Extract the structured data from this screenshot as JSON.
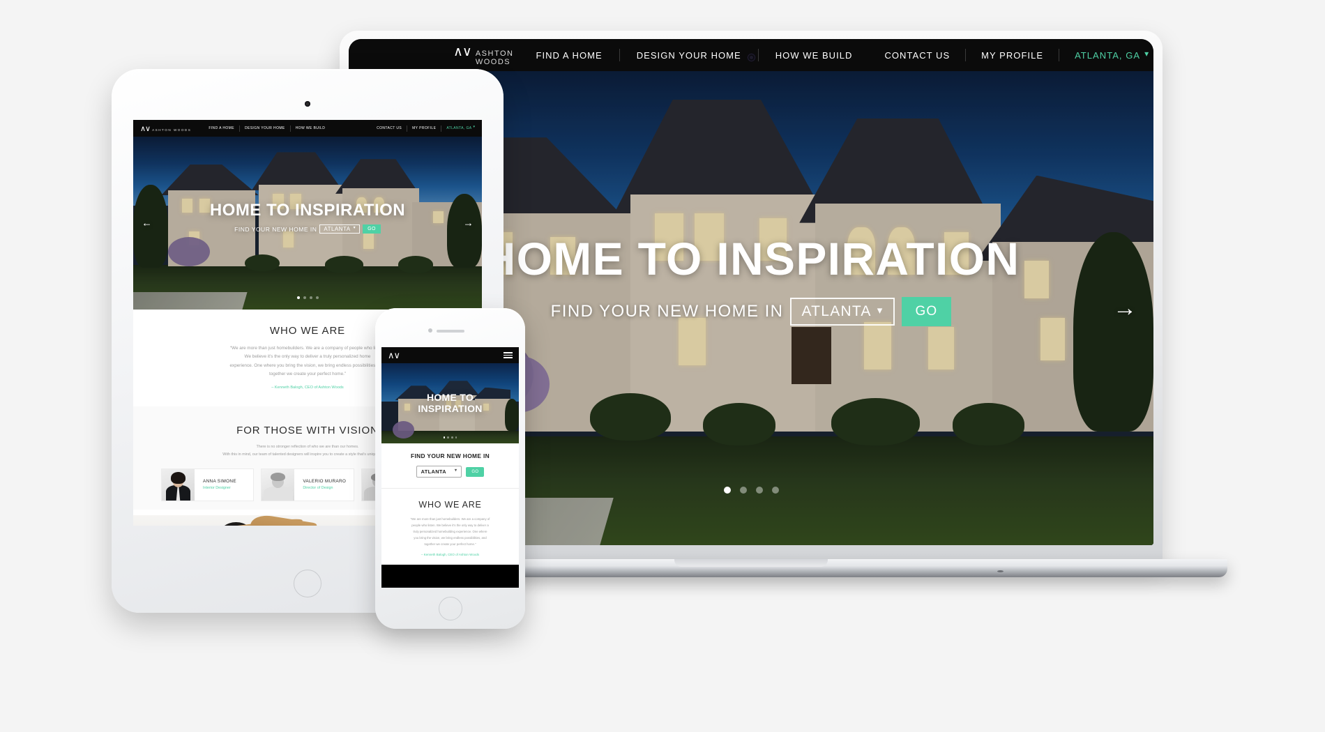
{
  "scene": {
    "background_color": "#f4f4f4",
    "devices": [
      "laptop",
      "tablet",
      "phone"
    ]
  },
  "brand": {
    "name": "ASHTON WOODS",
    "logo_mark": "AW",
    "accent_color": "#4fd1a5",
    "nav_background": "#0b0b0b"
  },
  "nav": {
    "links": [
      "FIND A HOME",
      "DESIGN YOUR HOME",
      "HOW WE BUILD"
    ],
    "right_links": [
      "CONTACT US",
      "MY PROFILE"
    ],
    "location": "ATLANTA, GA",
    "location_chevron": "chevron-down-icon",
    "mobile_menu_icon": "hamburger-icon"
  },
  "hero": {
    "title": "HOME TO INSPIRATION",
    "title_line1": "HOME TO",
    "title_line2": "INSPIRATION",
    "subtitle": "FIND YOUR NEW HOME IN",
    "city_selected": "ATLANTA",
    "city_options": [
      "ATLANTA"
    ],
    "go_label": "GO",
    "prev_icon": "arrow-left-icon",
    "next_icon": "arrow-right-icon",
    "slide_count": 4,
    "active_slide": 1,
    "photo_alt": "luxury-home-at-dusk"
  },
  "who_we_are": {
    "title": "WHO WE ARE",
    "quote": "“We are more than just homebuilders. We are a company of people who listen. We believe it’s the only way to deliver a truly personalized homebuilding experience. One where you bring the vision, we bring endless possibilities, and together we create your perfect home.”",
    "quote_lines": [
      "“We are more than just homebuilders. We are a company of people who listen.",
      "We believe it’s the only way to deliver a truly personalized home",
      "experience. One where you bring the vision, we bring endless possibilities, and",
      "together we create your perfect home.”"
    ],
    "quote_lines_phone": [
      "“We are more than just homebuilders. We are a company of",
      "people who listen. We believe it’s the only way to deliver a",
      "truly personalized homebuilding experience. One where",
      "you bring the vision, we bring endless possibilities, and",
      "together we create your perfect home.”"
    ],
    "attribution": "– Kenneth Balogh, CEO of Ashton Woods"
  },
  "vision": {
    "title": "FOR THOSE WITH VISION",
    "body_lines": [
      "There is no stronger reflection of who we are than our homes.",
      "With this in mind, our team of talented designers will inspire you to create a style that’s uniquely yours."
    ]
  },
  "designers": [
    {
      "name": "ANNA SIMONE",
      "role": "Interior Designer",
      "photo_alt": "portrait-anna-simone"
    },
    {
      "name": "VALERIO MURARO",
      "role": "Director of Design",
      "photo_alt": "portrait-valerio-muraro"
    },
    {
      "name": "",
      "role": "",
      "photo_alt": "portrait-third-designer"
    }
  ],
  "gallery": {
    "items": [
      {
        "photo_alt": "artisan-with-wood-slab"
      },
      {
        "photo_alt": "interior-detail"
      }
    ]
  }
}
